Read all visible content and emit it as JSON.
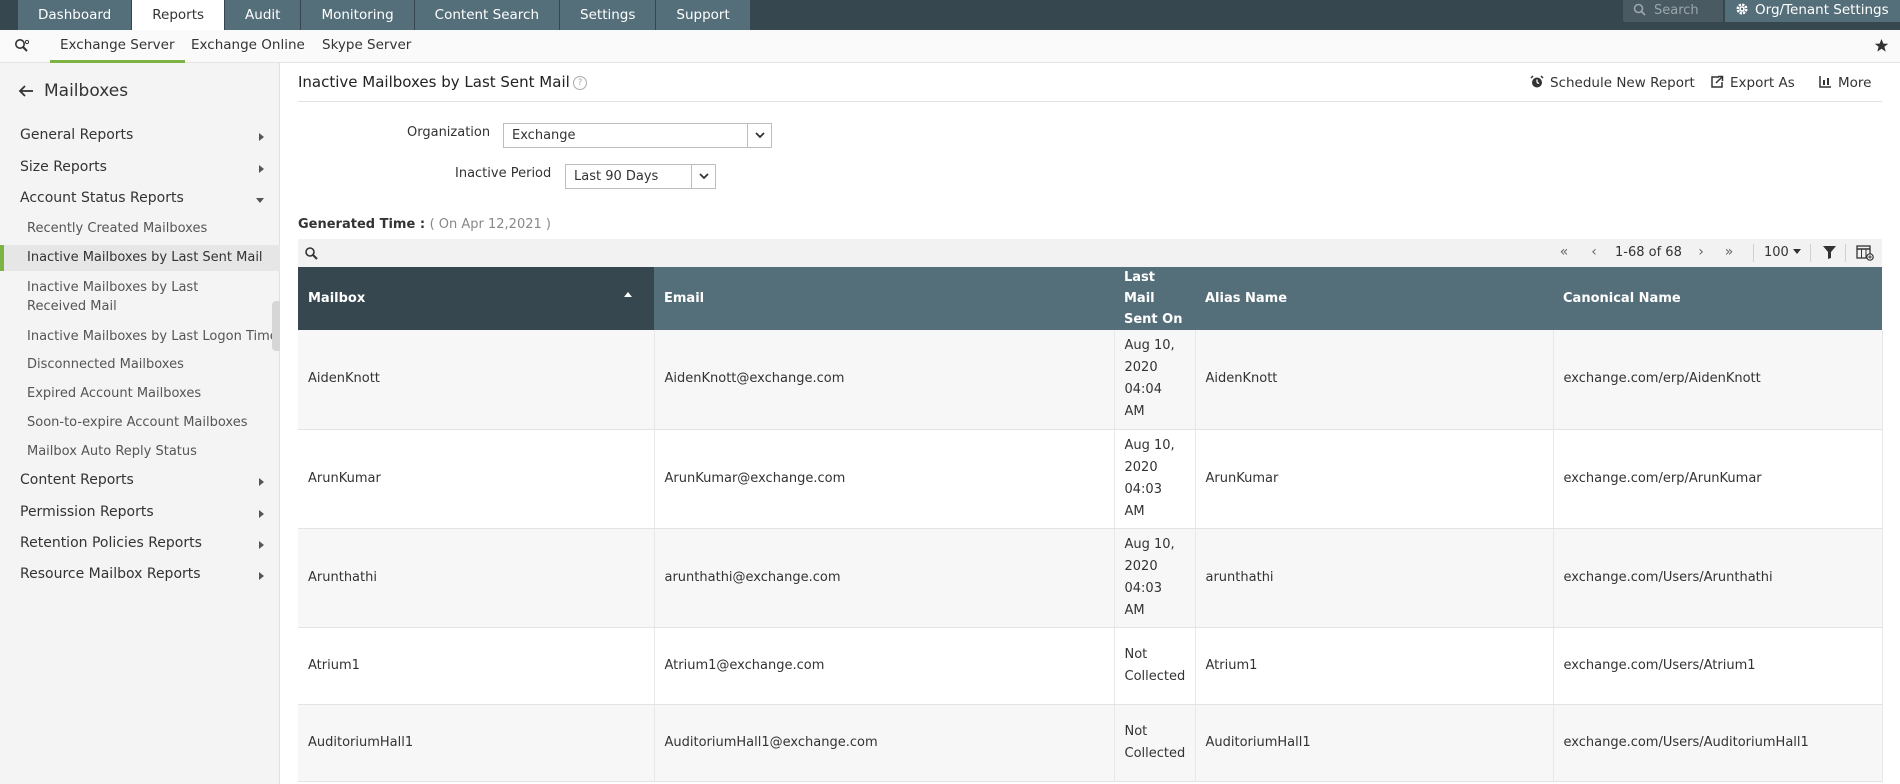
{
  "topnav": {
    "tabs": [
      "Dashboard",
      "Reports",
      "Audit",
      "Monitoring",
      "Content Search",
      "Settings",
      "Support"
    ],
    "active": "Reports",
    "search_placeholder": "Search",
    "org_settings": "Org/Tenant Settings"
  },
  "subnav": {
    "tabs": [
      "Exchange Server",
      "Exchange Online",
      "Skype Server"
    ],
    "active": "Exchange Server"
  },
  "sidebar": {
    "title": "Mailboxes",
    "groups": {
      "general": "General Reports",
      "size": "Size Reports",
      "account_status": "Account Status Reports",
      "content": "Content Reports",
      "permission": "Permission Reports",
      "retention": "Retention Policies Reports",
      "resource": "Resource Mailbox Reports"
    },
    "account_status_items": [
      "Recently Created Mailboxes",
      "Inactive Mailboxes by Last Sent Mail",
      "Inactive Mailboxes by Last Received Mail",
      "Inactive Mailboxes by Last Logon Time",
      "Disconnected Mailboxes",
      "Expired Account Mailboxes",
      "Soon-to-expire Account Mailboxes",
      "Mailbox Auto Reply Status"
    ],
    "active_item": "Inactive Mailboxes by Last Sent Mail"
  },
  "main": {
    "title": "Inactive Mailboxes by Last Sent Mail",
    "help": "?",
    "actions": {
      "schedule": "Schedule New Report",
      "export": "Export As",
      "more": "More"
    },
    "filters": {
      "organization_label": "Organization",
      "organization_value": "Exchange",
      "period_label": "Inactive Period",
      "period_value": "Last 90 Days"
    },
    "generated": {
      "label": "Generated Time :",
      "value": "( On Apr 12,2021 )"
    },
    "pager": {
      "range": "1-68 of 68",
      "page_size": "100",
      "first": "«",
      "prev": "‹",
      "next": "›",
      "last": "»"
    }
  },
  "table": {
    "headers": {
      "mailbox": "Mailbox",
      "email": "Email",
      "last_mail_1": "Last Mail",
      "last_mail_2": "Sent On",
      "alias": "Alias Name",
      "canonical": "Canonical Name"
    },
    "rows": [
      {
        "mailbox": "AidenKnott",
        "email": "AidenKnott@exchange.com",
        "last": [
          "Aug 10,",
          "2020",
          "04:04",
          "AM"
        ],
        "alias": "AidenKnott",
        "canonical": "exchange.com/erp/AidenKnott"
      },
      {
        "mailbox": "ArunKumar",
        "email": "ArunKumar@exchange.com",
        "last": [
          "Aug 10,",
          "2020",
          "04:03",
          "AM"
        ],
        "alias": "ArunKumar",
        "canonical": "exchange.com/erp/ArunKumar"
      },
      {
        "mailbox": "Arunthathi",
        "email": "arunthathi@exchange.com",
        "last": [
          "Aug 10,",
          "2020",
          "04:03",
          "AM"
        ],
        "alias": "arunthathi",
        "canonical": "exchange.com/Users/Arunthathi"
      },
      {
        "mailbox": "Atrium1",
        "email": "Atrium1@exchange.com",
        "last": [
          "Not",
          "Collected"
        ],
        "alias": "Atrium1",
        "canonical": "exchange.com/Users/Atrium1"
      },
      {
        "mailbox": "AuditoriumHall1",
        "email": "AuditoriumHall1@exchange.com",
        "last": [
          "Not",
          "Collected"
        ],
        "alias": "AuditoriumHall1",
        "canonical": "exchange.com/Users/AuditoriumHall1"
      }
    ]
  },
  "colors": {
    "nav_bg": "#37474f",
    "tab_bg": "#546e7a",
    "accent": "#7cb342"
  }
}
